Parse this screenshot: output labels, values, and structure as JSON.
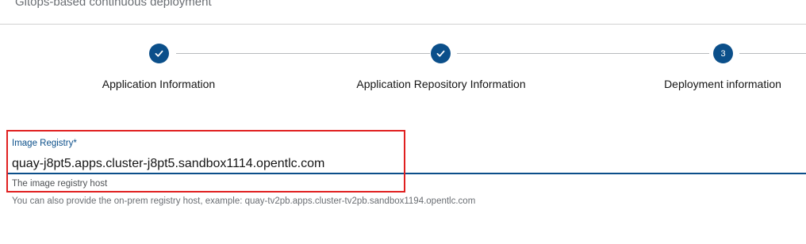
{
  "header": {
    "subtitle": "Gitops-based continuous deployment"
  },
  "stepper": {
    "steps": [
      {
        "label": "Application Information",
        "state": "completed",
        "icon": "check-icon"
      },
      {
        "label": "Application Repository Information",
        "state": "completed",
        "icon": "check-icon"
      },
      {
        "label": "Deployment information",
        "state": "current",
        "number": "3"
      }
    ],
    "colors": {
      "active": "#0b4f8a",
      "connector": "#b8bbbe"
    }
  },
  "form": {
    "image_registry": {
      "label": "Image Registry",
      "required_marker": "*",
      "value": "quay-j8pt5.apps.cluster-j8pt5.sandbox1114.opentlc.com",
      "helper": "The image registry host",
      "extra_helper": "You can also provide the on-prem registry host, example: quay-tv2pb.apps.cluster-tv2pb.sandbox1194.opentlc.com"
    }
  },
  "highlight": {
    "color": "#e02020"
  }
}
